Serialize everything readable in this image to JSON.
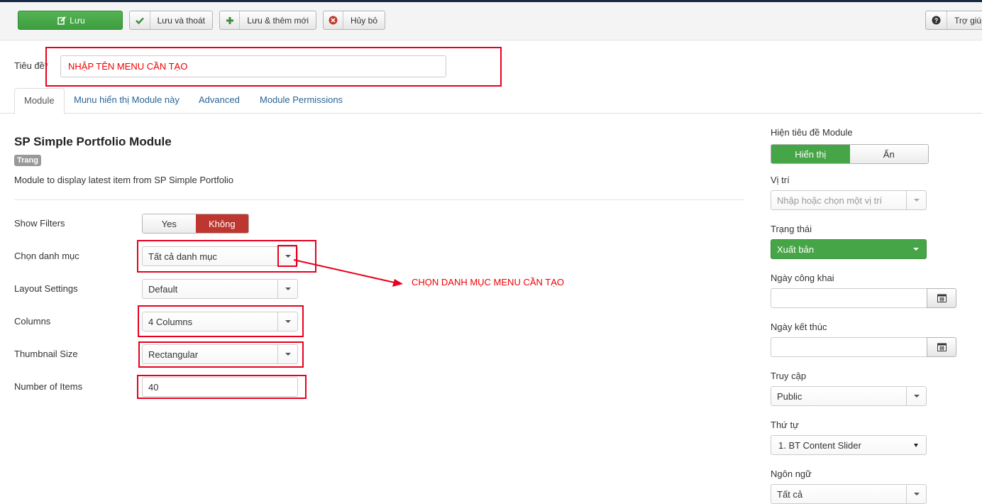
{
  "toolbar": {
    "save": "Lưu",
    "save_close": "Lưu và thoát",
    "save_new": "Lưu & thêm mới",
    "cancel": "Hủy bỏ",
    "help": "Trợ giúp"
  },
  "title_field": {
    "label": "Tiêu đề*",
    "value": "NHẬP TÊN MENU CẦN TẠO"
  },
  "tabs": [
    "Module",
    "Munu hiển thị Module này",
    "Advanced",
    "Module Permissions"
  ],
  "module": {
    "title": "SP Simple Portfolio Module",
    "badge": "Trang",
    "description": "Module to display latest item from SP Simple Portfolio"
  },
  "fields": {
    "show_filters": {
      "label": "Show Filters",
      "yes": "Yes",
      "no": "Không"
    },
    "category": {
      "label": "Chọn danh mục",
      "value": "Tất cả danh mục"
    },
    "layout": {
      "label": "Layout Settings",
      "value": "Default"
    },
    "columns": {
      "label": "Columns",
      "value": "4 Columns"
    },
    "thumbnail": {
      "label": "Thumbnail Size",
      "value": "Rectangular"
    },
    "items": {
      "label": "Number of Items",
      "value": "40"
    }
  },
  "annotation": "CHỌN DANH MỤC MENU CẦN TẠO",
  "sidebar": {
    "show_title": {
      "label": "Hiện tiêu đề Module",
      "show": "Hiển thị",
      "hide": "Ẩn"
    },
    "position": {
      "label": "Vị trí",
      "placeholder": "Nhập hoặc chọn một vị trí"
    },
    "status": {
      "label": "Trạng thái",
      "value": "Xuất bản"
    },
    "publish_up": {
      "label": "Ngày công khai"
    },
    "publish_down": {
      "label": "Ngày kết thúc"
    },
    "access": {
      "label": "Truy cập",
      "value": "Public"
    },
    "ordering": {
      "label": "Thứ tự",
      "value": "1. BT Content Slider"
    },
    "language": {
      "label": "Ngôn ngữ",
      "value": "Tất cả"
    }
  },
  "colors": {
    "green": "#46a546",
    "red_active": "#bd362f",
    "annotation_red": "#e8001c",
    "link": "#2a6496"
  },
  "icons": [
    "edit-icon",
    "check-icon",
    "plus-icon",
    "cancel-circle-icon",
    "help-icon",
    "calendar-icon",
    "caret-down-icon"
  ]
}
